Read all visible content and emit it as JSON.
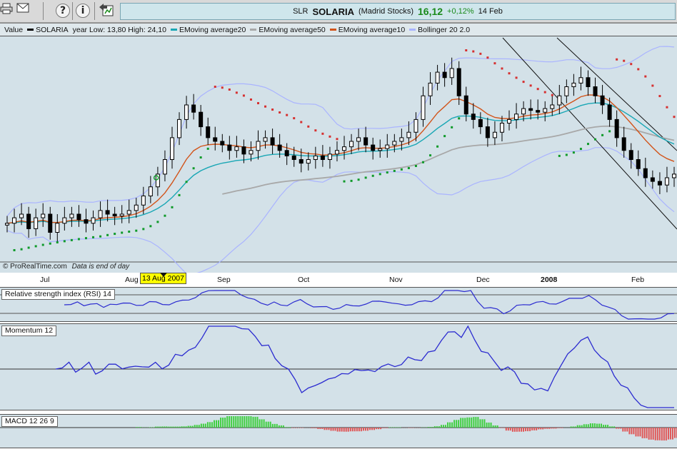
{
  "toolbar": {
    "icons": [
      "printer-icon",
      "envelope-icon",
      "help-icon",
      "info-icon",
      "back-icon"
    ]
  },
  "quote": {
    "ticker": "SLR",
    "name": "SOLARIA",
    "exchange": "(Madrid Stocks)",
    "price": "16,12",
    "change": "+0,12%",
    "date": "14 Feb"
  },
  "legend": {
    "value": "Value",
    "series": "SOLARIA",
    "range": "year Low: 13,80 High: 24,10",
    "ema20": "EMoving average20",
    "ema50": "EMoving average50",
    "ema10": "EMoving average10",
    "bollinger": "Bollinger 20 2.0"
  },
  "colors": {
    "ema20": "#19a7b5",
    "ema50": "#a8a8a8",
    "ema10": "#d2541a",
    "bollinger": "#aab4ff",
    "sar_up": "#0f9a2a",
    "sar_down": "#d63030",
    "indicator": "#2b2bd0",
    "macd_pos": "#3fcf3f",
    "macd_neg": "#e05555"
  },
  "footer": {
    "source": "© ProRealTime.com",
    "note": "Data is end of day"
  },
  "axis": {
    "months": [
      "Jul",
      "Aug",
      "Sep",
      "Oct",
      "Nov",
      "Dec",
      "2008",
      "Feb"
    ],
    "cursor_date": "13 Aug 2007"
  },
  "panels": {
    "rsi": "Relative strength index (RSI) 14",
    "momentum": "Momentum 12",
    "macd": "MACD 12 26 9"
  },
  "chart_data": {
    "type": "candlestick",
    "title": "SOLARIA",
    "period": "Jul 2007 – Feb 2008",
    "last_close": 16.12,
    "year_low": 13.8,
    "year_high": 24.1,
    "close": [
      0.15,
      0.18,
      0.2,
      0.12,
      0.18,
      0.2,
      0.1,
      0.15,
      0.18,
      0.2,
      0.17,
      0.15,
      0.18,
      0.22,
      0.2,
      0.19,
      0.2,
      0.22,
      0.25,
      0.3,
      0.35,
      0.42,
      0.5,
      0.62,
      0.72,
      0.8,
      0.76,
      0.68,
      0.62,
      0.6,
      0.58,
      0.55,
      0.57,
      0.53,
      0.55,
      0.6,
      0.62,
      0.58,
      0.55,
      0.52,
      0.5,
      0.48,
      0.5,
      0.52,
      0.5,
      0.53,
      0.55,
      0.57,
      0.6,
      0.62,
      0.58,
      0.55,
      0.56,
      0.58,
      0.6,
      0.62,
      0.65,
      0.72,
      0.85,
      0.92,
      0.98,
      0.95,
      1.0,
      0.85,
      0.75,
      0.72,
      0.68,
      0.62,
      0.65,
      0.7,
      0.72,
      0.75,
      0.78,
      0.77,
      0.76,
      0.78,
      0.8,
      0.85,
      0.9,
      0.92,
      0.95,
      0.9,
      0.85,
      0.8,
      0.72,
      0.62,
      0.55,
      0.5,
      0.45,
      0.4,
      0.38,
      0.36,
      0.4,
      0.42
    ]
  }
}
